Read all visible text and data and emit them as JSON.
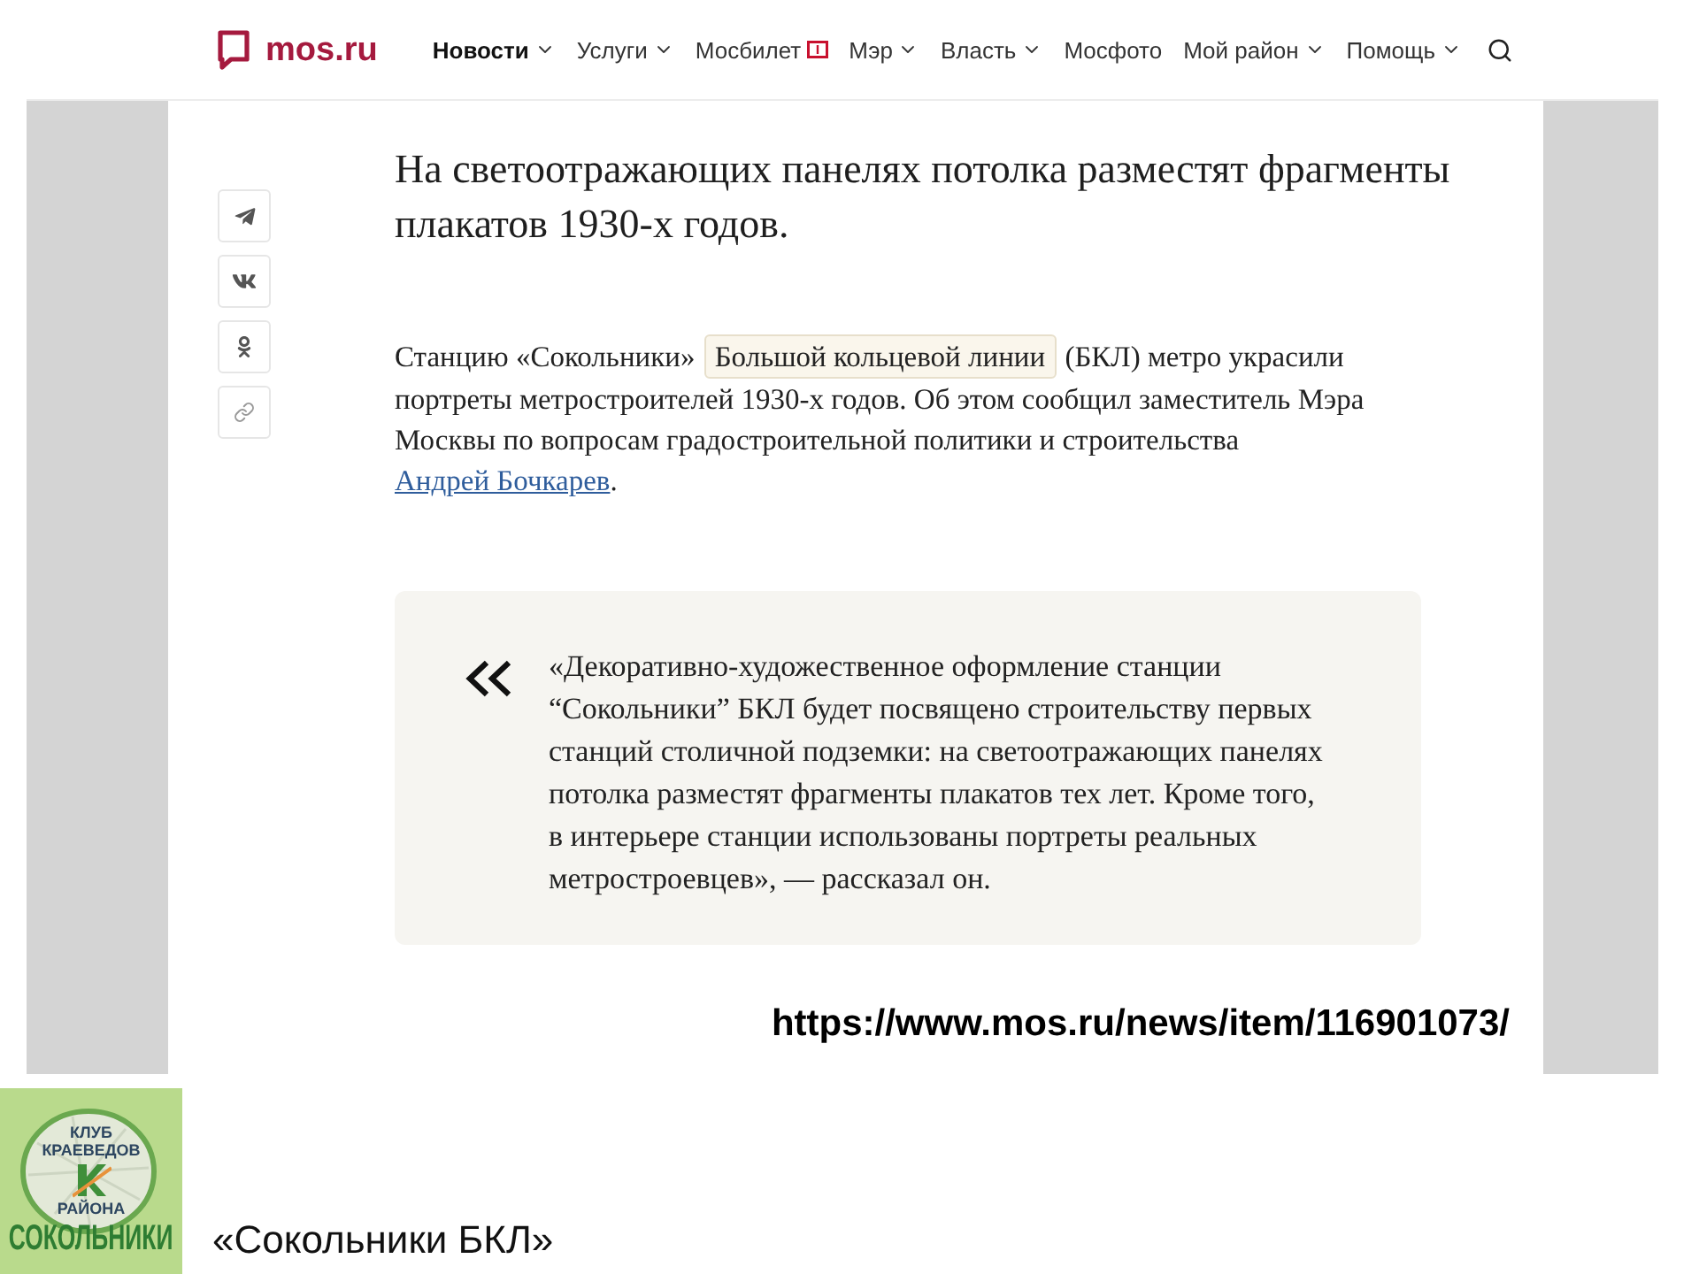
{
  "header": {
    "logo_text": "mos.ru",
    "nav": [
      {
        "label": "Новости",
        "kind": "dropdown",
        "selected": true
      },
      {
        "label": "Услуги",
        "kind": "dropdown",
        "selected": false
      },
      {
        "label": "Мосбилет",
        "kind": "ticket",
        "selected": false
      },
      {
        "label": "Мэр",
        "kind": "dropdown",
        "selected": false
      },
      {
        "label": "Власть",
        "kind": "dropdown",
        "selected": false
      },
      {
        "label": "Мосфото",
        "kind": "link",
        "selected": false
      },
      {
        "label": "Мой район",
        "kind": "dropdown",
        "selected": false
      },
      {
        "label": "Помощь",
        "kind": "dropdown",
        "selected": false
      }
    ]
  },
  "share_buttons": [
    {
      "kind": "telegram"
    },
    {
      "kind": "vk"
    },
    {
      "kind": "ok"
    },
    {
      "kind": "link"
    }
  ],
  "article": {
    "title": "На светоотражающих панелях потолка разместят фрагменты плакатов 1930-х годов.",
    "paragraph": [
      {
        "kind": "text",
        "text": "Станцию «Сокольники» "
      },
      {
        "kind": "tag",
        "text": "Большой кольцевой линии"
      },
      {
        "kind": "text",
        "text": " (БКЛ) метро украсили портреты метростроителей 1930-х годов. Об этом сообщил заместитель Мэра Москвы по вопросам градостроительной политики и строительства "
      },
      {
        "kind": "link",
        "text": "Андрей Бочкарев"
      },
      {
        "kind": "text",
        "text": "."
      }
    ],
    "quote": "«Декоративно-художественное оформление станции “Сокольники” БКЛ будет посвящено строительству первых станций столичной подземки: на светоотражающих панелях потолка разместят фрагменты плакатов тех лет. Кроме того, в интерьере станции использованы портреты реальных метростроевцев», — рассказал он."
  },
  "source_url": "https://www.mos.ru/news/item/116901073/",
  "club_logo": {
    "lines": [
      "КЛУБ",
      "КРАЕВЕДОВ",
      "РАЙОНА"
    ],
    "name": "СОКОЛЬНИКИ"
  },
  "caption": "«Сокольники БКЛ»"
}
